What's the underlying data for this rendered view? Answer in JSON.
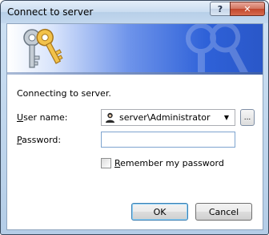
{
  "window": {
    "title": "Connect to server",
    "help_label": "?",
    "close_label": "✕"
  },
  "banner": {
    "icon": "keys-icon",
    "watermark": "keys-watermark-icon"
  },
  "form": {
    "intro": "Connecting to server.",
    "username_label_accel": "U",
    "username_label_rest": "ser name:",
    "username_value": "server\\Administrator",
    "username_icon": "user-icon",
    "browse_label": "...",
    "password_label_accel": "P",
    "password_label_rest": "assword:",
    "password_value": "",
    "remember_label_accel": "R",
    "remember_label_rest": "emember my password",
    "remember_checked": false
  },
  "buttons": {
    "ok": "OK",
    "cancel": "Cancel"
  },
  "colors": {
    "banner_start": "#ffffff",
    "banner_end": "#2a57c8",
    "key_gold": "#e0b23a",
    "key_silver": "#b8c2cc"
  }
}
